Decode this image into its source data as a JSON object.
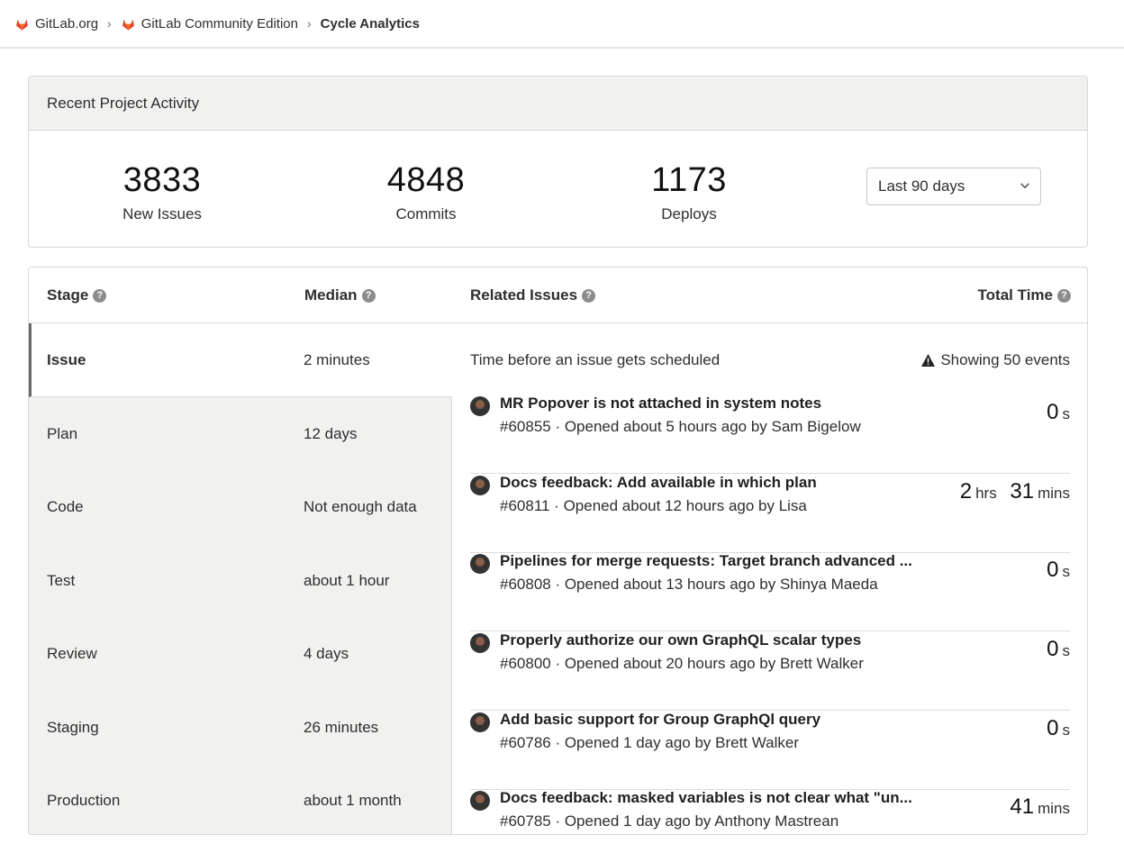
{
  "breadcrumb": {
    "items": [
      {
        "label": "GitLab.org"
      },
      {
        "label": "GitLab Community Edition"
      },
      {
        "label": "Cycle Analytics"
      }
    ],
    "separator": "›"
  },
  "activity": {
    "title": "Recent Project Activity",
    "stats": [
      {
        "value": "3833",
        "label": "New Issues"
      },
      {
        "value": "4848",
        "label": "Commits"
      },
      {
        "value": "1173",
        "label": "Deploys"
      }
    ],
    "range_select": {
      "value": "Last 90 days"
    }
  },
  "table": {
    "headers": {
      "stage": "Stage",
      "median": "Median",
      "related": "Related Issues",
      "total": "Total Time"
    },
    "stages": [
      {
        "name": "Issue",
        "median": "2 minutes"
      },
      {
        "name": "Plan",
        "median": "12 days"
      },
      {
        "name": "Code",
        "median": "Not enough data"
      },
      {
        "name": "Test",
        "median": "about 1 hour"
      },
      {
        "name": "Review",
        "median": "4 days"
      },
      {
        "name": "Staging",
        "median": "26 minutes"
      },
      {
        "name": "Production",
        "median": "about 1 month"
      }
    ],
    "description": "Time before an issue gets scheduled",
    "events_note": "Showing 50 events",
    "issues": [
      {
        "title": "MR Popover is not attached in system notes",
        "meta": "#60855 · Opened about 5 hours ago by Sam Bigelow",
        "time": [
          {
            "n": "0",
            "u": "s"
          }
        ]
      },
      {
        "title": "Docs feedback: Add available in which plan",
        "meta": "#60811 · Opened about 12 hours ago by Lisa",
        "time": [
          {
            "n": "2",
            "u": "hrs"
          },
          {
            "n": "31",
            "u": "mins"
          }
        ]
      },
      {
        "title": "Pipelines for merge requests: Target branch advanced ...",
        "meta": "#60808 · Opened about 13 hours ago by Shinya Maeda",
        "time": [
          {
            "n": "0",
            "u": "s"
          }
        ]
      },
      {
        "title": "Properly authorize our own GraphQL scalar types",
        "meta": "#60800 · Opened about 20 hours ago by Brett Walker",
        "time": [
          {
            "n": "0",
            "u": "s"
          }
        ]
      },
      {
        "title": "Add basic support for Group GraphQl query",
        "meta": "#60786 · Opened 1 day ago by Brett Walker",
        "time": [
          {
            "n": "0",
            "u": "s"
          }
        ]
      },
      {
        "title": "Docs feedback: masked variables is not clear what \"un...",
        "meta": "#60785 · Opened 1 day ago by Anthony Mastrean",
        "time": [
          {
            "n": "41",
            "u": "mins"
          }
        ]
      }
    ]
  },
  "colors": {
    "gitlab_orange": "#e24329",
    "panel_header_bg": "#f1f2f0",
    "border": "#d9d9d9"
  }
}
